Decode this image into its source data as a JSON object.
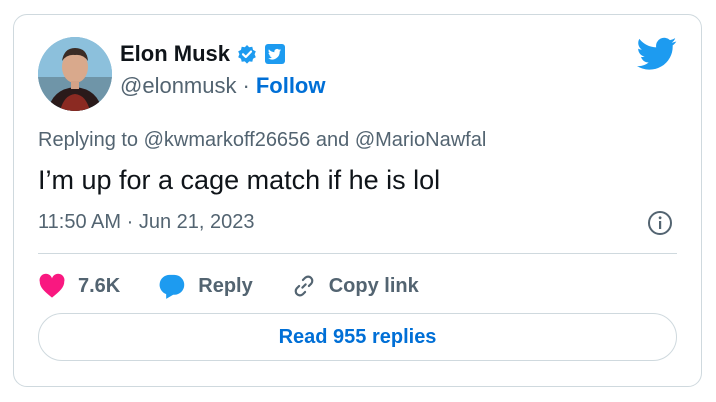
{
  "author": {
    "name": "Elon Musk",
    "handle": "@elonmusk",
    "separator": "·",
    "follow_label": "Follow"
  },
  "tweet": {
    "reply_prefix": "Replying to",
    "reply_mention_1": "@kwmarkoff26656",
    "reply_conjunction": "and",
    "reply_mention_2": "@MarioNawfal",
    "text": "I’m up for a cage match if he is lol",
    "time": "11:50 AM",
    "date_separator": "·",
    "date": "Jun 21, 2023"
  },
  "actions": {
    "likes": "7.6K",
    "reply_label": "Reply",
    "copy_label": "Copy link"
  },
  "read_replies_label": "Read 955 replies",
  "colors": {
    "link_blue": "#006fd6",
    "verified_blue": "#1d9bf0",
    "like_pink": "#f91880",
    "muted_text": "#536471",
    "border": "#cfd9de"
  },
  "icons": [
    "avatar",
    "verified-icon",
    "bird-badge-icon",
    "twitter-logo-icon",
    "info-icon",
    "heart-icon",
    "reply-bubble-icon",
    "link-icon"
  ]
}
